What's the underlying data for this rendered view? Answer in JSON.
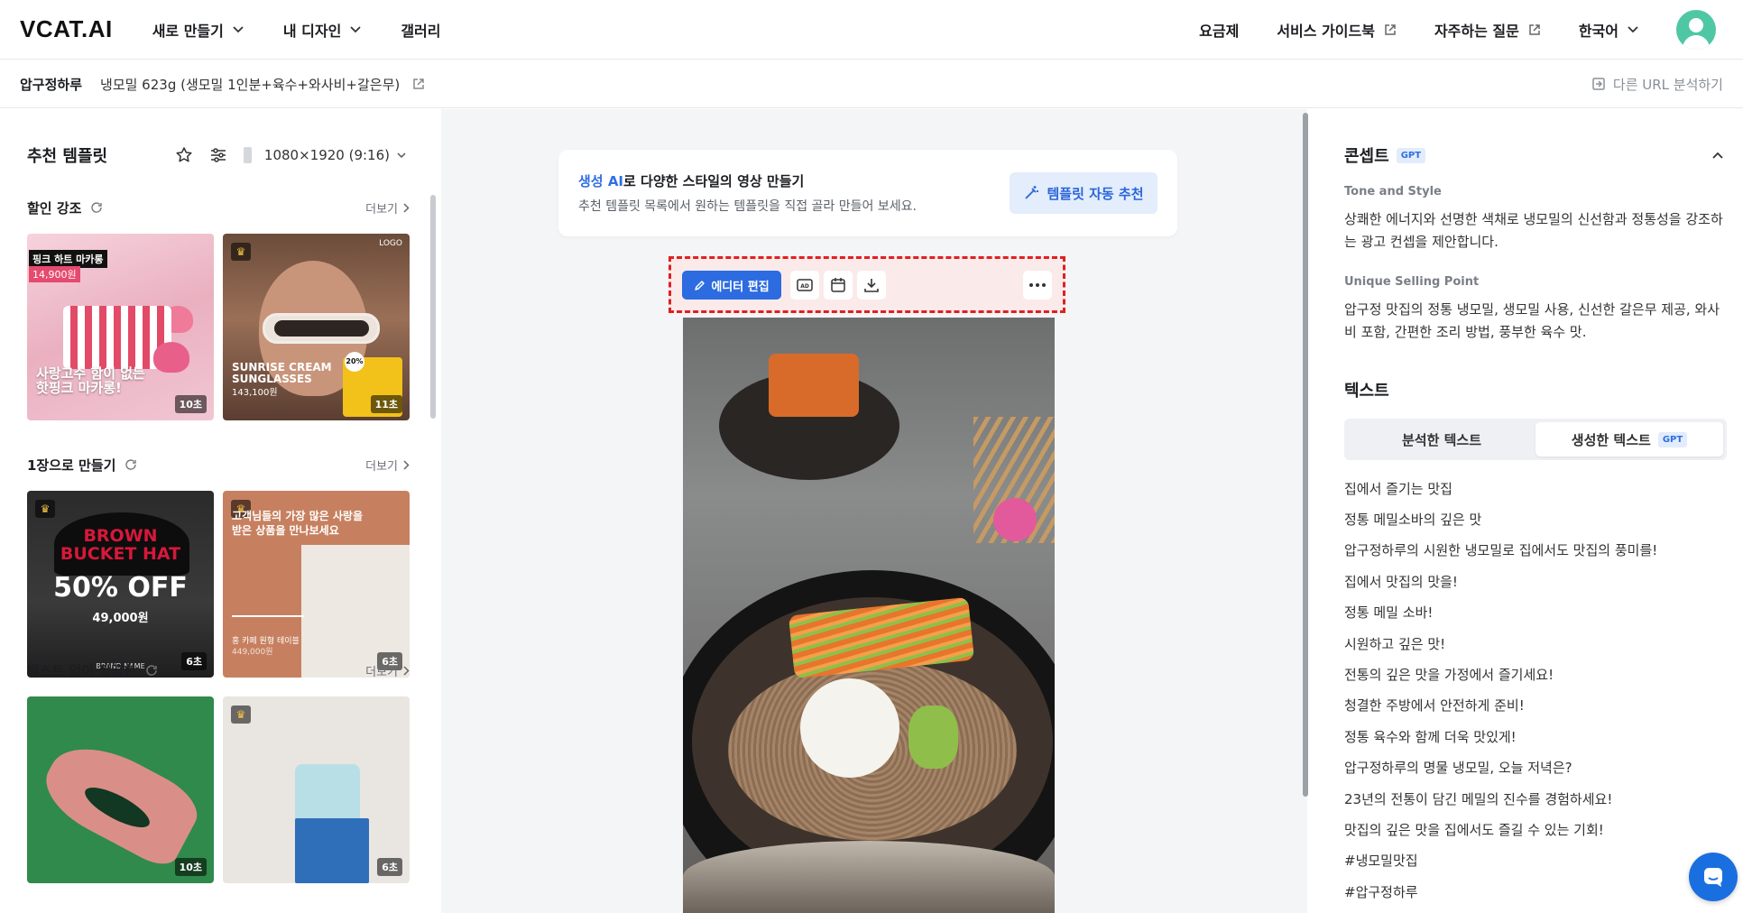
{
  "app": {
    "logo": "VCAT.AI"
  },
  "nav": {
    "left": [
      {
        "label": "새로 만들기"
      },
      {
        "label": "내 디자인"
      },
      {
        "label": "갤러리"
      }
    ],
    "right": [
      {
        "label": "요금제"
      },
      {
        "label": "서비스 가이드북"
      },
      {
        "label": "자주하는 질문"
      },
      {
        "label": "한국어"
      }
    ]
  },
  "product": {
    "store": "압구정하루",
    "name": "냉모밀 623g (생모밀 1인분+육수+와사비+갈은무)",
    "analyze_label": "다른 URL 분석하기"
  },
  "left": {
    "title": "추천 템플릿",
    "ratio": "1080×1920 (9:16)",
    "more_label": "더보기",
    "sections": [
      {
        "title": "할인 강조",
        "cards": [
          {
            "tag": "핑크 하트 마카롱",
            "price": "14,900원",
            "caption": "사랑고수 함이 없는\n핫핑크 마카롱!",
            "duration": "10초"
          },
          {
            "logo": "LOGO",
            "caption": "SUNRISE CREAM\nSUNGLASSES",
            "price": "143,100원",
            "badge": "20%",
            "duration": "11초"
          }
        ]
      },
      {
        "title": "1장으로 만들기",
        "cards": [
          {
            "t1": "BROWN\nBUCKET HAT",
            "t2": "50% OFF",
            "t3": "49,000원",
            "t4": "BRAND NAME",
            "duration": "6초"
          },
          {
            "caption": "고객님들의 가장 많은 사랑을\n받은 상품을 만나보세요",
            "name": "홍 카페 원형 테이블",
            "price": "449,000원",
            "duration": "6초"
          }
        ]
      },
      {
        "title": "텍스트 없이 깔끔한",
        "cards": [
          {
            "duration": "10초"
          },
          {
            "duration": "6초"
          }
        ]
      }
    ]
  },
  "center": {
    "banner": {
      "title_highlight": "생성 AI",
      "title_rest": "로 다양한 스타일의 영상 만들기",
      "subtitle": "추천 템플릿 목록에서 원하는 템플릿을 직접 골라 만들어 보세요.",
      "button": "템플릿 자동 추천"
    },
    "toolbar": {
      "edit_label": "에디터 편집",
      "ad_label": "AD"
    }
  },
  "right": {
    "concept_title": "콘셉트",
    "gpt_badge": "GPT",
    "tone_label": "Tone and Style",
    "tone_text": "상쾌한 에너지와 선명한 색채로 냉모밀의 신선함과 정통성을 강조하는 광고 컨셉을 제안합니다.",
    "usp_label": "Unique Selling Point",
    "usp_text": "압구정 맛집의 정통 냉모밀, 생모밀 사용, 신선한 갈은무 제공, 와사비 포함, 간편한 조리 방법, 풍부한 육수 맛.",
    "text_title": "텍스트",
    "tabs": [
      {
        "label": "분석한 텍스트"
      },
      {
        "label": "생성한 텍스트"
      }
    ],
    "texts": [
      "집에서 즐기는 맛집",
      "정통 메밀소바의 깊은 맛",
      "압구정하루의 시원한 냉모밀로 집에서도 맛집의 풍미를!",
      "집에서 맛집의 맛을!",
      "정통 메밀 소바!",
      "시원하고 깊은 맛!",
      "전통의 깊은 맛을 가정에서 즐기세요!",
      "청결한 주방에서 안전하게 준비!",
      "정통 육수와 함께 더욱 맛있게!",
      "압구정하루의 명물 냉모밀, 오늘 저녁은?",
      "23년의 전통이 담긴 메밀의 진수를 경험하세요!",
      "맛집의 깊은 맛을 집에서도 즐길 수 있는 기회!",
      "#냉모밀맛집",
      "#압구정하루"
    ]
  },
  "colors": {
    "accent": "#2c6be0",
    "highlight_border": "#e02020",
    "gpt_badge_bg": "#e2ecfb"
  }
}
